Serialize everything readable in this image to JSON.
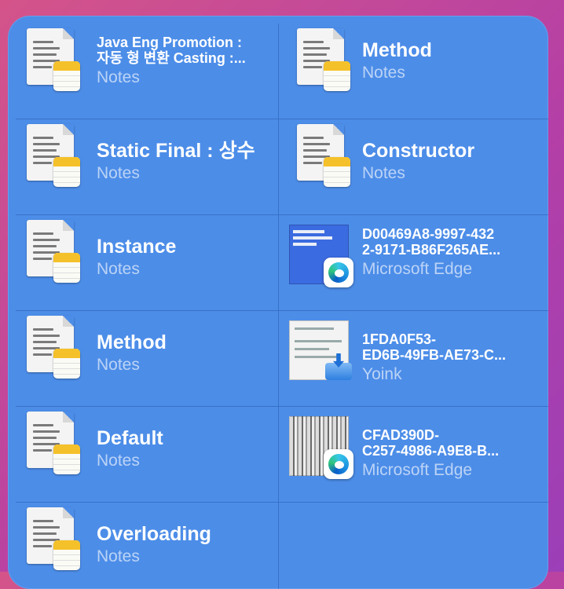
{
  "items": [
    {
      "title": "Java Eng Promotion :",
      "title2": "자동 형 변환 Casting :...",
      "app": "Notes",
      "thumb": "notes-document-icon"
    },
    {
      "title": "Method",
      "app": "Notes",
      "thumb": "notes-document-icon"
    },
    {
      "title": "Static Final : 상수",
      "app": "Notes",
      "thumb": "notes-document-icon"
    },
    {
      "title": "Constructor",
      "app": "Notes",
      "thumb": "notes-document-icon"
    },
    {
      "title": "Instance",
      "app": "Notes",
      "thumb": "notes-document-icon"
    },
    {
      "title": "D00469A8-9997-432",
      "title2": "2-9171-B86F265AE...",
      "app": "Microsoft Edge",
      "thumb": "screenshot-thumbnail"
    },
    {
      "title": "Method",
      "app": "Notes",
      "thumb": "notes-document-icon"
    },
    {
      "title": "1FDA0F53-",
      "title2": "ED6B-49FB-AE73-C...",
      "app": "Yoink",
      "thumb": "screenshot-thumbnail"
    },
    {
      "title": "Default",
      "app": "Notes",
      "thumb": "notes-document-icon"
    },
    {
      "title": "CFAD390D-",
      "title2": "C257-4986-A9E8-B...",
      "app": "Microsoft Edge",
      "thumb": "screenshot-thumbnail"
    },
    {
      "title": "Overloading",
      "app": "Notes",
      "thumb": "notes-document-icon"
    }
  ],
  "colors": {
    "panel": "#4c8de8",
    "background": "#c04a9a"
  }
}
